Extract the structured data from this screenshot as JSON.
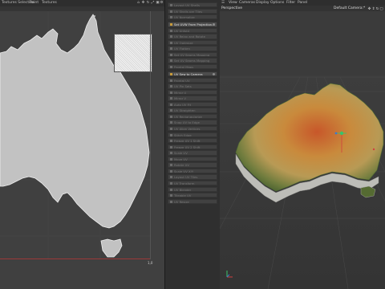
{
  "uv_editor": {
    "menu": [
      "Textures Selection",
      "Paint",
      "Textures"
    ],
    "coord_label": "1,0",
    "toolbar_icons": [
      "home-icon",
      "move-icon",
      "rotate-icon",
      "scale-icon",
      "fit-icon",
      "settings-icon"
    ]
  },
  "tool_list": {
    "items": [
      {
        "label": "Layout UV Shells",
        "active": false
      },
      {
        "label": "UV Shells per Tiles",
        "active": false
      },
      {
        "label": "UV Normalize",
        "active": false
      },
      {
        "label": "Set UVW From Projection...",
        "active": true
      },
      {
        "label": "UV Unfold",
        "active": false
      },
      {
        "label": "UV Relax and Rotate",
        "active": false
      },
      {
        "label": "UV Optimize",
        "active": false
      },
      {
        "label": "UV Flatten",
        "active": false
      },
      {
        "label": "Set UV Seams Mapping",
        "active": false
      },
      {
        "label": "Set UV Seams Mapping",
        "active": false
      },
      {
        "label": "Frontal Maps",
        "active": false
      },
      {
        "label": "UV Sew to Camera",
        "active": true
      },
      {
        "label": "Frontal UV",
        "active": false
      },
      {
        "label": "UV Pin Sets",
        "active": false
      },
      {
        "label": "Mirror U",
        "active": false
      },
      {
        "label": "Mirror V",
        "active": false
      },
      {
        "label": "Auto UV Fit",
        "active": false
      },
      {
        "label": "UV Straighten",
        "active": false
      },
      {
        "label": "UV Rectangularize",
        "active": false
      },
      {
        "label": "Snap UV to Edge",
        "active": false
      },
      {
        "label": "UV Align Vertices",
        "active": false
      },
      {
        "label": "Stitch Edge",
        "active": false
      },
      {
        "label": "Freeze UV 1 Shift",
        "active": false
      },
      {
        "label": "Freeze UV 2 Shift",
        "active": false
      },
      {
        "label": "Scale UV",
        "active": false
      },
      {
        "label": "Move UV",
        "active": false
      },
      {
        "label": "Rotate UV",
        "active": false
      },
      {
        "label": "Scale UV X/Y",
        "active": false
      },
      {
        "label": "Layout UV Tiles",
        "active": false
      },
      {
        "label": "UV Transform",
        "active": false
      },
      {
        "label": "UV Blender",
        "active": false
      },
      {
        "label": "Tileable UV",
        "active": false
      },
      {
        "label": "UV Resize",
        "active": false
      }
    ]
  },
  "viewport": {
    "menu": [
      "View",
      "Cameras",
      "Display",
      "Options",
      "Filter",
      "Panel"
    ],
    "title": "Perspective",
    "camera": "Default Camera:*",
    "header_icons": [
      "move-view-icon",
      "zoom-view-icon",
      "rotate-view-icon",
      "maximize-icon"
    ]
  },
  "colors": {
    "ui_bg": "#2b2b2b",
    "uv_bg": "#404040",
    "map_fill": "#c2c2c2",
    "active_accent": "#c79a3a",
    "gizmo_y": "#39c46a",
    "gizmo_x": "#d04040",
    "gizmo_z": "#3a7ad0"
  }
}
